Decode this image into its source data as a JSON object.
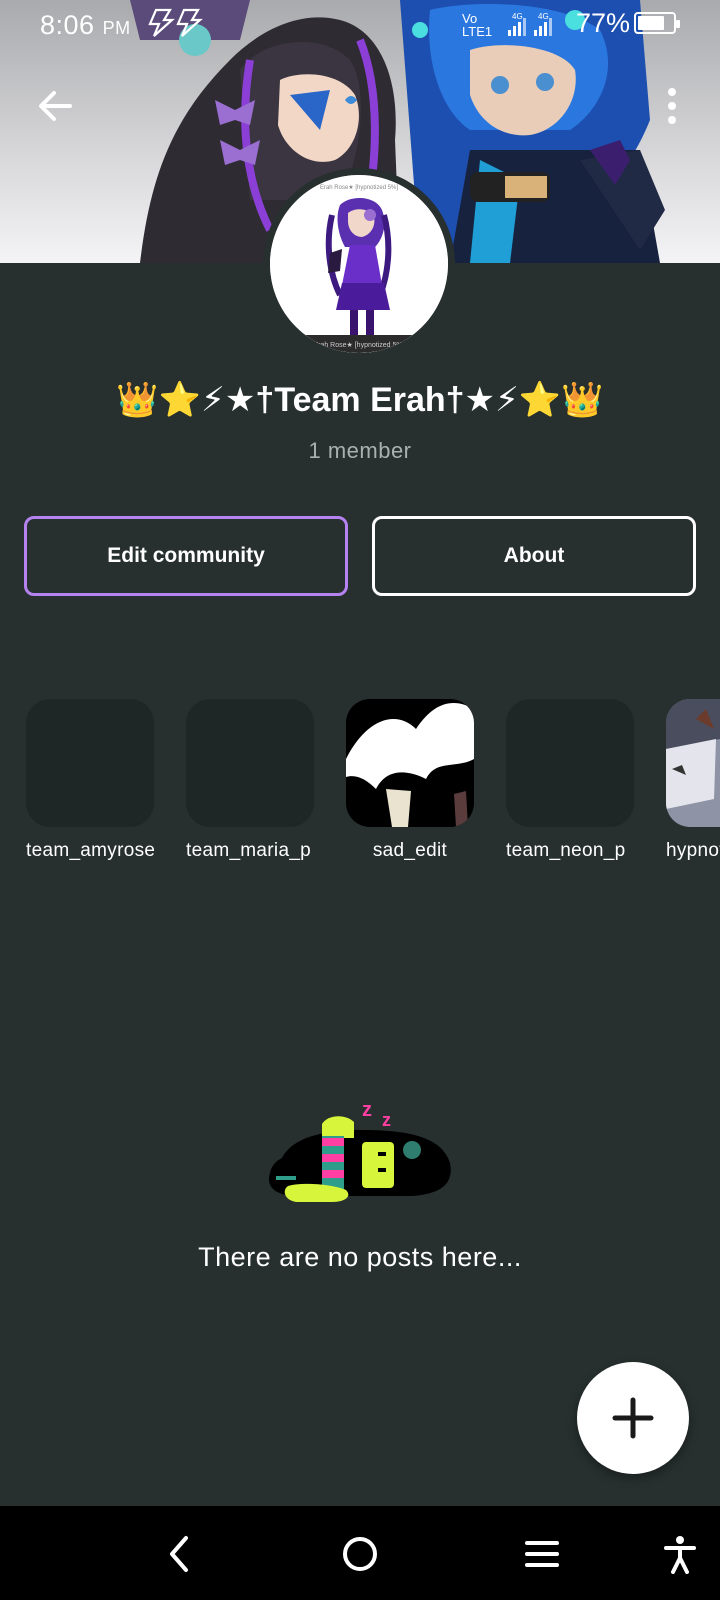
{
  "status_bar": {
    "time": "8:06",
    "ampm": "PM",
    "network_vo": "Vo",
    "network_lte": "LTE1",
    "network_4g_1": "4G",
    "network_4g_2": "4G",
    "battery_percent": "77%",
    "battery_level": 0.77
  },
  "community": {
    "name": "👑⭐⚡★†Team Erah†★⚡⭐👑",
    "members": "1 member",
    "avatar_caption": "Erah Rose★ [hypnotized 5%]"
  },
  "actions": {
    "edit_label": "Edit community",
    "about_label": "About"
  },
  "linked_communities": [
    {
      "label": "team_amyrose"
    },
    {
      "label": "team_maria_p"
    },
    {
      "label": "sad_edit"
    },
    {
      "label": "team_neon_p"
    },
    {
      "label": "hypnotized"
    }
  ],
  "empty_state": {
    "text": "There are no posts here..."
  },
  "colors": {
    "background": "#272f2f",
    "edit_border": "#b583f0",
    "tile_bg": "#1f2626",
    "muted_text": "#a9b0b0"
  },
  "icons": {
    "back": "arrow-left-icon",
    "more": "more-vertical-icon",
    "fab": "plus-icon",
    "nav_back": "chevron-left-icon",
    "nav_home": "circle-home-icon",
    "nav_menu": "menu-icon",
    "nav_accessibility": "accessibility-icon"
  }
}
